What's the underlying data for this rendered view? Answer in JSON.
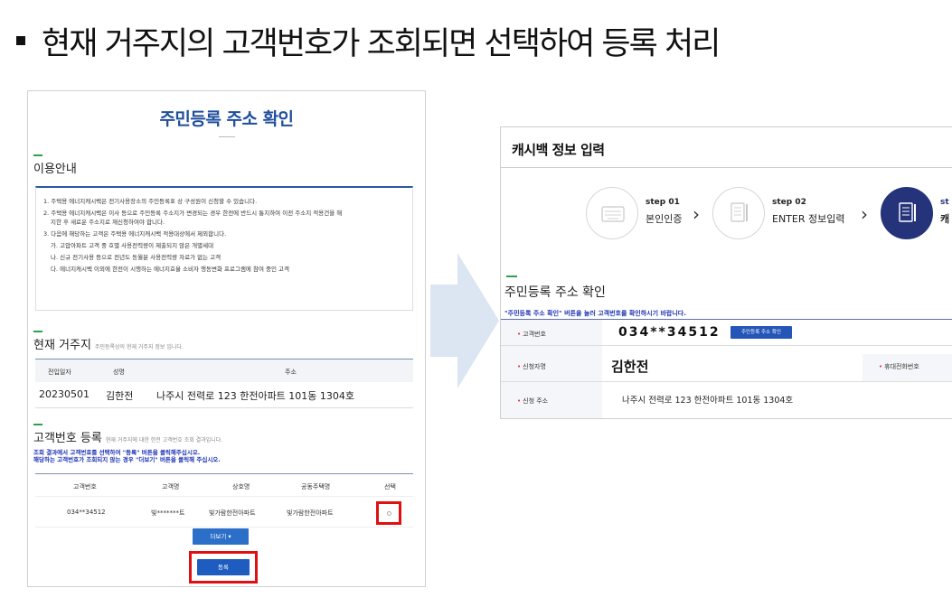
{
  "headline": "현재 거주지의 고객번호가 조회되면 선택하여 등록 처리",
  "left": {
    "title": "주민등록 주소 확인",
    "guide": {
      "title": "이용안내",
      "lines": [
        "1. 주택용 에너지캐시백은 전기사용장소의 주민등록표 상 구성원이 신청할 수 있습니다.",
        "2. 주택용 에너지캐시백은 이사 등으로 주민등록 주소지가 변경되는 경우 한전에 반드시 통지하여 이전 주소지 적용건을 해",
        "지한 후 새로운 주소지로 재신청하여야 합니다.",
        "3. 다음에 해당하는 고객은 주택용 에너지캐시백 적용대상에서 제외합니다.",
        "가. 고압아파트 고객 중 호별 사용전력량이 제출되지 않은 개별세대",
        "나. 신규 전기사용 등으로 전년도 동월분 사용전력량 자료가 없는 고객",
        "다. 에너지캐시백 이외에 한전이 시행하는 에너지효율 소비자 행동변화 프로그램에 참여 중인 고객"
      ]
    },
    "residence": {
      "title": "현재 거주지",
      "subtitle": "주민등록상의 현재 거주지 정보 입니다.",
      "headers": [
        "전입일자",
        "성명",
        "주소"
      ],
      "row": [
        "20230501",
        "김한전",
        "나주시 전력로 123 한전아파트 101동 1304호"
      ]
    },
    "customer": {
      "title": "고객번호 등록",
      "subtitle": "현재 거주지에 대한 한전 고객번호 조회 결과입니다.",
      "note1": "조회 결과에서 고객번호를 선택하여 \"등록\" 버튼을 클릭해주십시오.",
      "note2": "해당하는 고객번호가 조회되지 않는 경우 \"더보기\" 버튼을 클릭해 주십시오.",
      "headers": [
        "고객번호",
        "고객명",
        "상호명",
        "공동주택명",
        "선택"
      ],
      "row": [
        "034**34512",
        "빛*******트",
        "빛가람한전아파트",
        "빛가람한전아파트"
      ],
      "more_label": "더보기 ▾",
      "register_label": "등록"
    }
  },
  "right": {
    "title": "캐시백 정보 입력",
    "steps": [
      {
        "num": "step 01",
        "name": "본인인증"
      },
      {
        "num": "step 02",
        "name": "ENTER 정보입력"
      },
      {
        "num": "st",
        "name": "캐"
      }
    ],
    "section_title": "주민등록 주소 확인",
    "note": "\"주민등록 주소 확인\" 버튼을 눌러 고객번호를 확인하시기 바랍니다.",
    "labels": {
      "customer_no": "고객번호",
      "applicant": "신청자명",
      "phone": "휴대전화번호",
      "address": "신청 주소"
    },
    "customer_no": "034**34512",
    "check_button": "주민등록 주소 확인",
    "applicant": "김한전",
    "address": "나주시 전력로 123 한전아파트 101동 1304호"
  }
}
